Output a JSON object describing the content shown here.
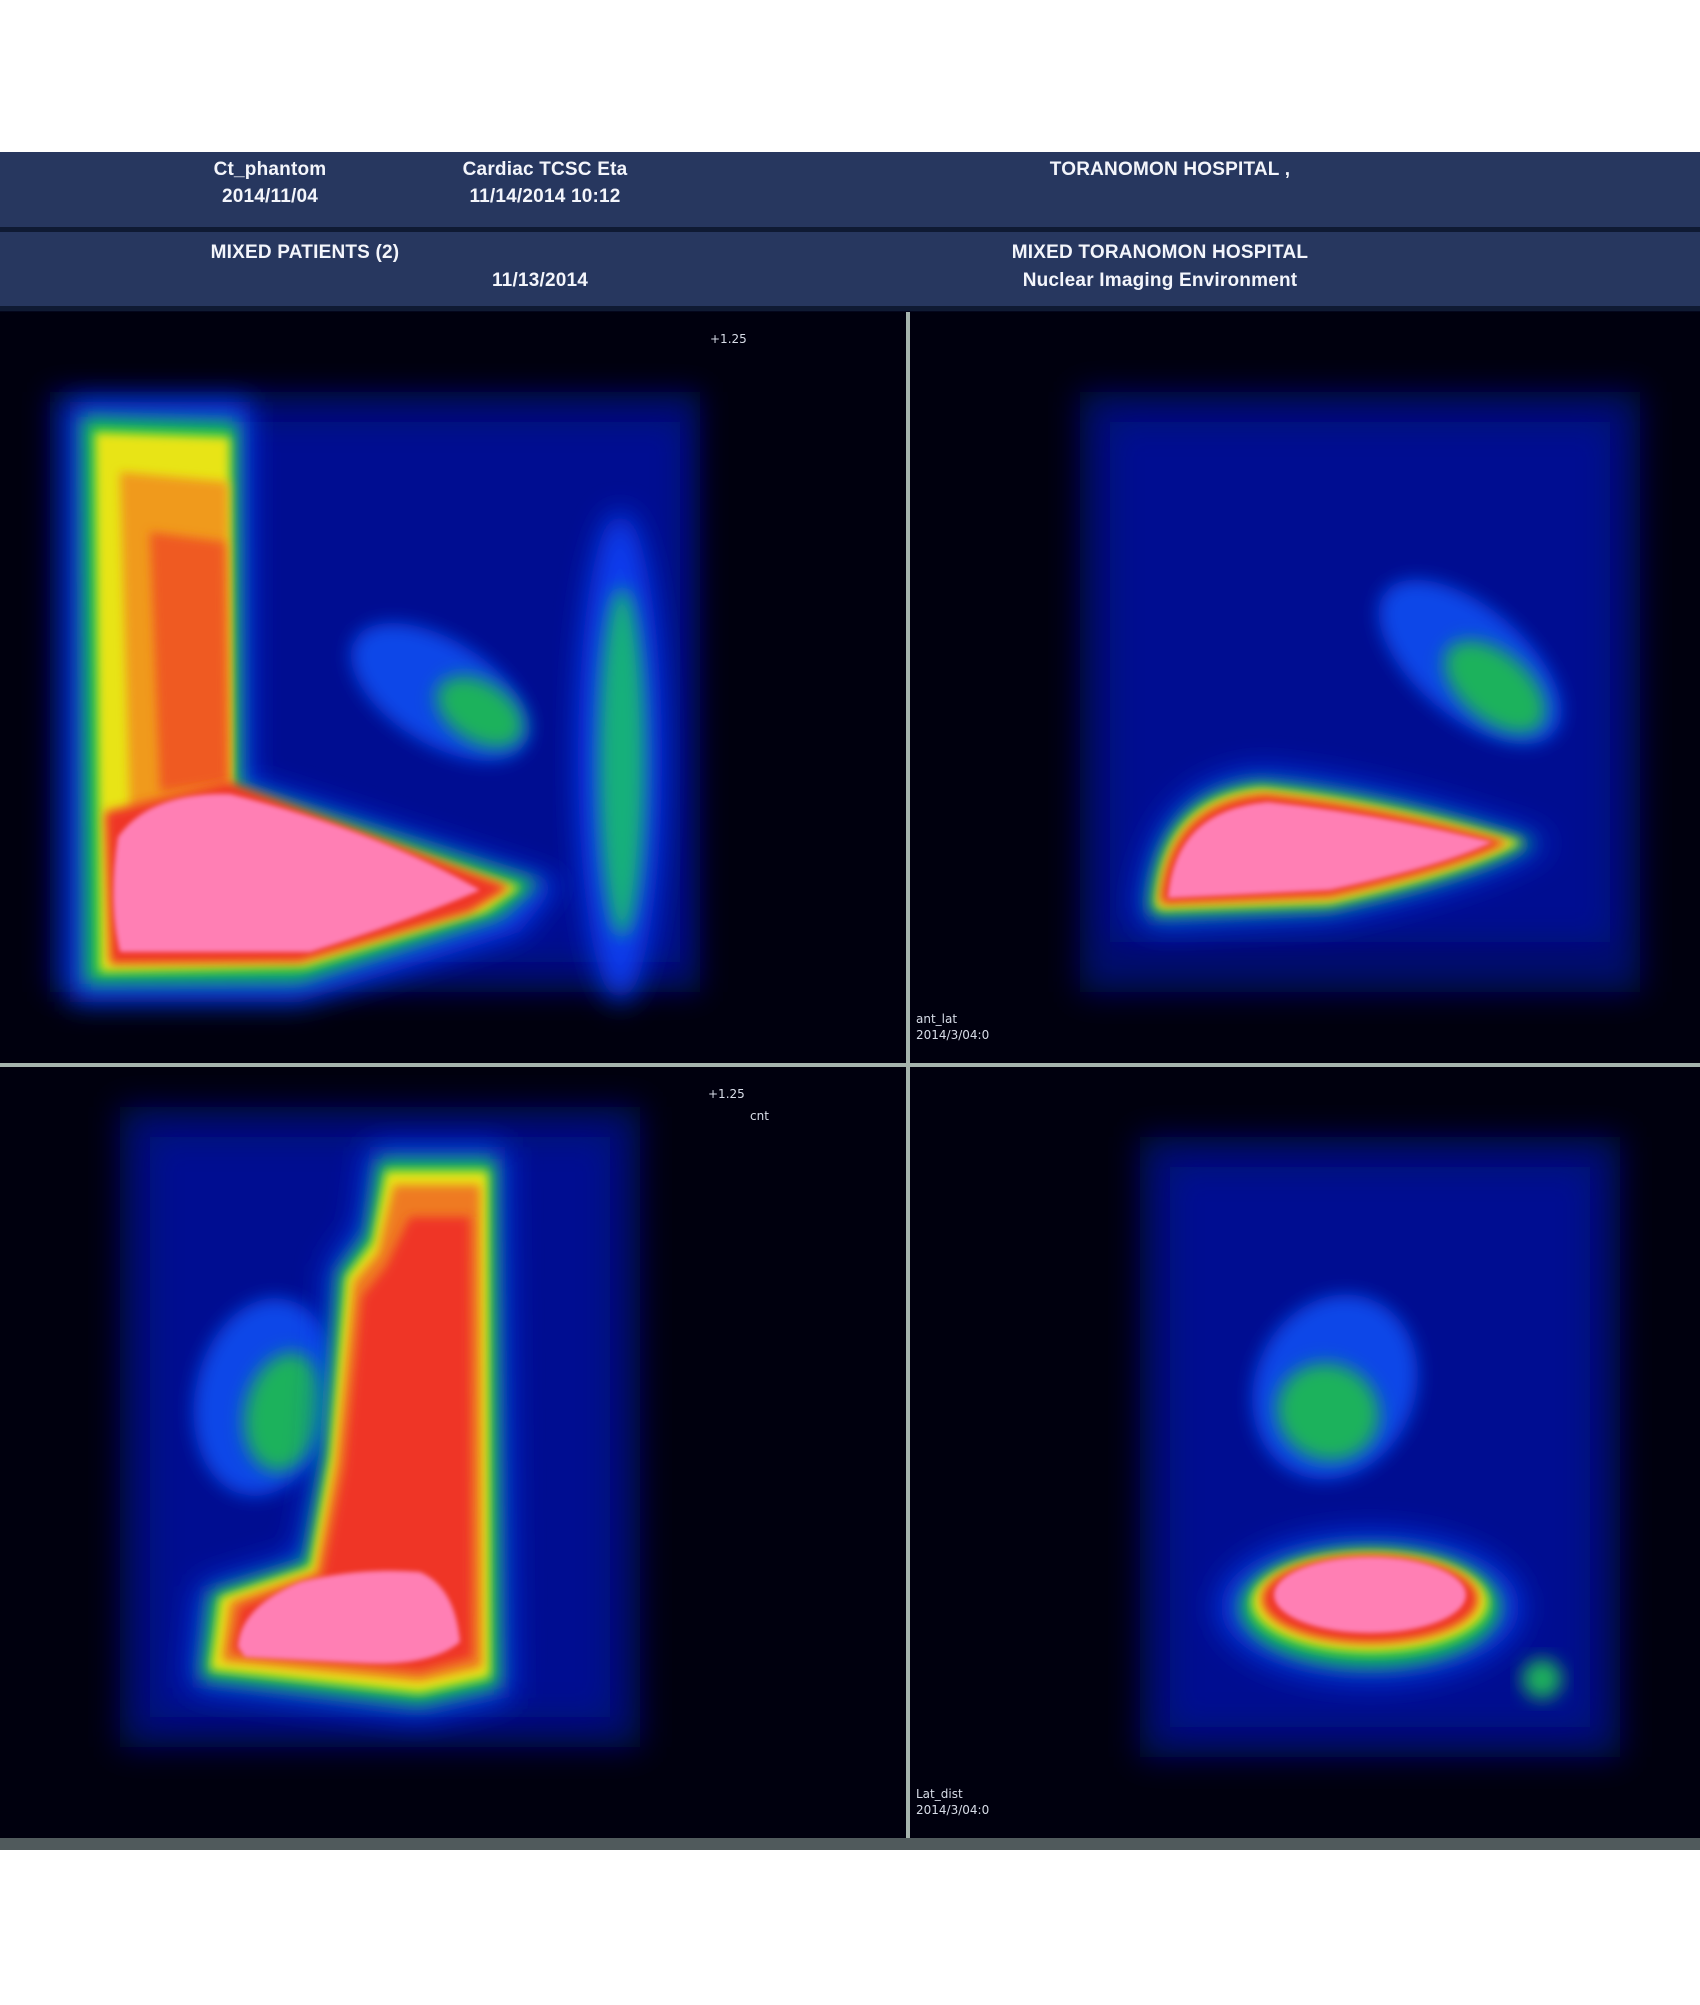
{
  "header_top": {
    "patient_name": "Ct_phantom",
    "patient_id": "2014/11/04",
    "study_name": "Cardiac TCSC Eta",
    "study_datetime": "11/14/2014 10:12",
    "institution": "TORANOMON HOSPITAL ,"
  },
  "header_second": {
    "group_name": "MIXED PATIENTS (2)",
    "group_date": "11/13/2014",
    "site_name": "MIXED TORANOMON HOSPITAL",
    "department": "Nuclear Imaging Environment"
  },
  "panels": {
    "top_left": {
      "corner_label": "+1.25",
      "corner_label_2": ""
    },
    "top_right": {
      "view_name": "ant_lat",
      "view_date": "2014/3/04:0"
    },
    "bottom_left": {
      "corner_label": "+1.25",
      "corner_label_2": "cnt"
    },
    "bottom_right": {
      "view_name": "Lat_dist",
      "view_date": "2014/3/04:0"
    }
  },
  "colors": {
    "header_bg": "#27375f",
    "viewport_bg": "#00000e",
    "divider": "#a5b3ad",
    "hot_max": "#ff7fb4"
  }
}
